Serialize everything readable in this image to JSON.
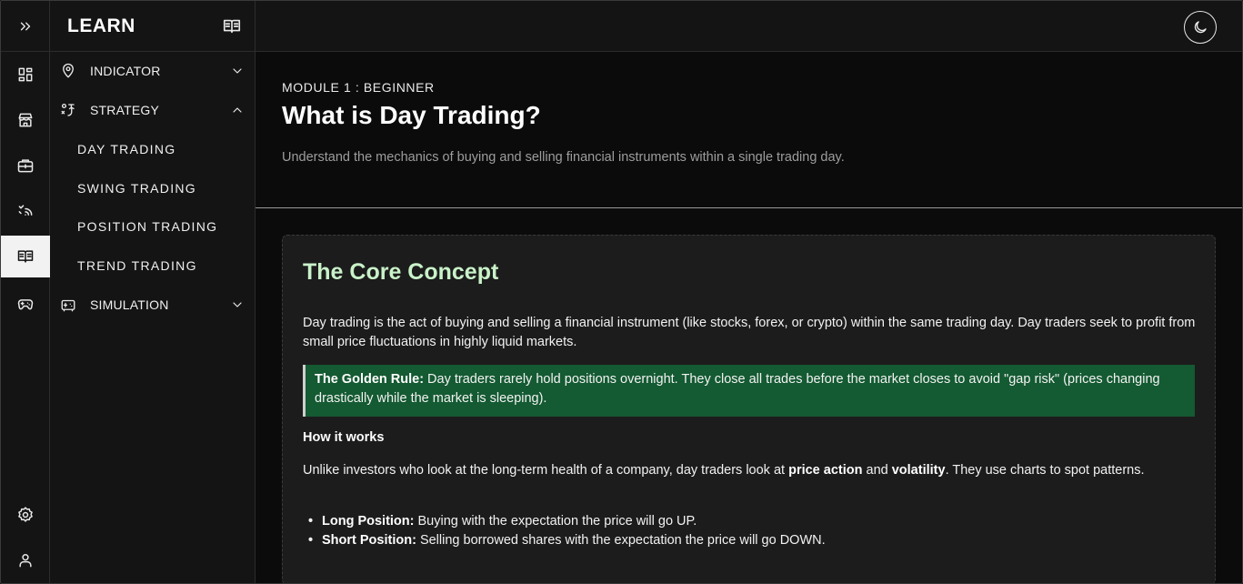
{
  "sidebar": {
    "title": "LEARN",
    "nav": [
      {
        "label": "INDICATOR",
        "icon": "map-pin-icon",
        "expanded": false
      },
      {
        "label": "STRATEGY",
        "icon": "strategy-icon",
        "expanded": true
      },
      {
        "label": "SIMULATION",
        "icon": "simulation-icon",
        "expanded": false
      }
    ],
    "strategy_items": [
      "DAY TRADING",
      "SWING TRADING",
      "POSITION TRADING",
      "TREND TRADING"
    ]
  },
  "rail": {
    "icons": [
      "expand-icon",
      "dashboard-icon",
      "store-icon",
      "briefcase-icon",
      "signal-icon",
      "book-icon",
      "gamepad-icon",
      "settings-icon",
      "user-icon"
    ],
    "active": "book-icon"
  },
  "topbar": {
    "theme_toggle_icon": "moon-icon"
  },
  "hero": {
    "module": "MODULE 1 : BEGINNER",
    "title": "What is Day Trading?",
    "subtitle": "Understand the mechanics of buying and selling financial instruments within a single trading day."
  },
  "card": {
    "heading": "The Core Concept",
    "intro": "Day trading is the act of buying and selling a financial instrument (like stocks, forex, or crypto) within the same trading day. Day traders seek to profit from small price fluctuations in highly liquid markets.",
    "callout_label": "The Golden Rule:",
    "callout_text": " Day traders rarely hold positions overnight. They close all trades before the market closes to avoid \"gap risk\" (prices changing drastically while the market is sleeping).",
    "how_heading": "How it works",
    "how_p1": "Unlike investors who look at the long-term health of a company, day traders look at ",
    "how_b1": "price action",
    "how_p2": " and ",
    "how_b2": "volatility",
    "how_p3": ". They use charts to spot patterns.",
    "bullets": [
      {
        "label": "Long Position:",
        "text": " Buying with the expectation the price will go UP."
      },
      {
        "label": "Short Position:",
        "text": " Selling borrowed shares with the expectation the price will go DOWN."
      }
    ]
  },
  "colors": {
    "accent_heading": "#c9f2c9",
    "callout_bg": "#145a32",
    "background": "#0b0b0b",
    "panel": "#141414"
  }
}
